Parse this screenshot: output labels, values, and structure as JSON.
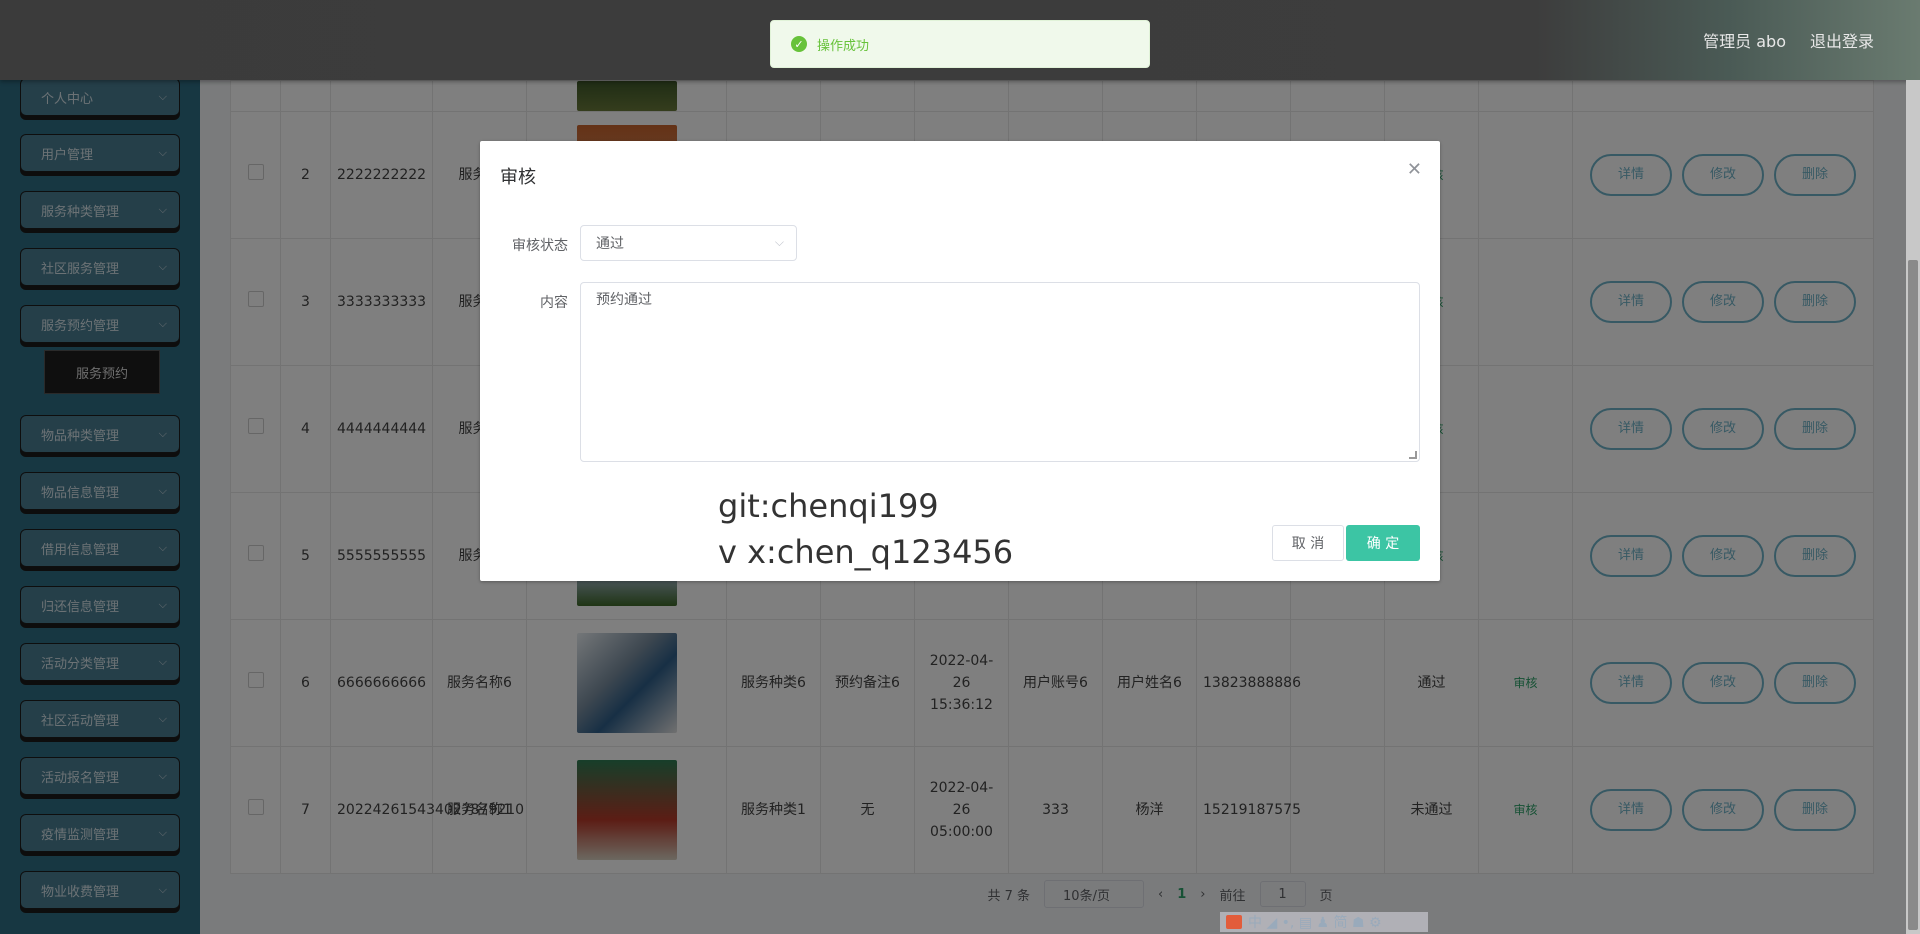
{
  "header": {
    "user_label": "管理员 abo",
    "logout_label": "退出登录"
  },
  "toast": {
    "message": "操作成功"
  },
  "sidebar": {
    "items": [
      {
        "label": "个人中心"
      },
      {
        "label": "用户管理"
      },
      {
        "label": "服务种类管理"
      },
      {
        "label": "社区服务管理"
      },
      {
        "label": "服务预约管理"
      },
      {
        "label": "物品种类管理"
      },
      {
        "label": "物品信息管理"
      },
      {
        "label": "借用信息管理"
      },
      {
        "label": "归还信息管理"
      },
      {
        "label": "活动分类管理"
      },
      {
        "label": "社区活动管理"
      },
      {
        "label": "活动报名管理"
      },
      {
        "label": "疫情监测管理"
      },
      {
        "label": "物业收费管理"
      }
    ],
    "submenu_label": "服务预约"
  },
  "table": {
    "ops": {
      "detail": "详情",
      "edit": "修改",
      "delete": "删除",
      "audit": "审核"
    },
    "rows": [
      {
        "index": "2",
        "no": "2222222222",
        "name": "服务名",
        "cat": "",
        "remark": "",
        "time": "",
        "acct": "",
        "uname": "",
        "phone": "",
        "status": ""
      },
      {
        "index": "3",
        "no": "3333333333",
        "name": "服务名",
        "cat": "",
        "remark": "",
        "time": "",
        "acct": "",
        "uname": "",
        "phone": "",
        "status": ""
      },
      {
        "index": "4",
        "no": "4444444444",
        "name": "服务名",
        "cat": "",
        "remark": "",
        "time": "",
        "acct": "",
        "uname": "",
        "phone": "",
        "status": ""
      },
      {
        "index": "5",
        "no": "5555555555",
        "name": "服务名",
        "cat": "",
        "remark": "",
        "time": "",
        "acct": "",
        "uname": "",
        "phone": "",
        "status": ""
      },
      {
        "index": "6",
        "no": "6666666666",
        "name": "服务名称6",
        "cat": "服务种类6",
        "remark": "预约备注6",
        "time": "2022-04-26 15:36:12",
        "acct": "用户账号6",
        "uname": "用户姓名6",
        "phone": "13823888886",
        "status": "通过"
      },
      {
        "index": "7",
        "no": "202242615434027879210",
        "name": "服务名称1",
        "cat": "服务种类1",
        "remark": "无",
        "time": "2022-04-26 05:00:00",
        "acct": "333",
        "uname": "杨洋",
        "phone": "15219187575",
        "status": "未通过"
      }
    ]
  },
  "pager": {
    "total": "共 7 条",
    "size": "10条/页",
    "current": "1",
    "goto_label": "前往",
    "goto_value": "1",
    "page_unit": "页"
  },
  "dialog": {
    "title": "审核",
    "status_label": "审核状态",
    "status_value": "通过",
    "content_label": "内容",
    "content_value": "预约通过",
    "watermark_line1": "git:chenqi199",
    "watermark_line2": "v x:chen_q123456",
    "cancel_label": "取 消",
    "ok_label": "确 定"
  },
  "ime": {
    "text": "中 ◢ •, ▤ ♟ 简 ☗ ⚙"
  }
}
